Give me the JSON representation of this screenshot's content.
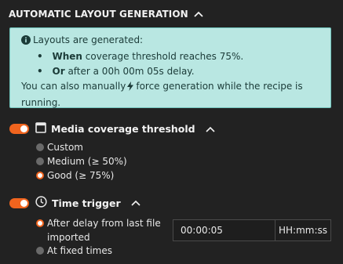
{
  "header": {
    "title": "AUTOMATIC LAYOUT GENERATION"
  },
  "info": {
    "intro": "Layouts are generated:",
    "bullet1_strong": "When",
    "bullet1_rest": " coverage threshold reaches 75%.",
    "bullet2_strong": "Or",
    "bullet2_rest": " after a 00h 00m 05s delay.",
    "manual_pre": "You can also manually",
    "manual_post": "force generation while the recipe is",
    "manual_last": "running."
  },
  "coverage": {
    "label": "Media coverage threshold",
    "enabled": true,
    "options": [
      {
        "label": "Custom",
        "selected": false
      },
      {
        "label": "Medium (≥ 50%)",
        "selected": false
      },
      {
        "label": "Good (≥ 75%)",
        "selected": true
      }
    ]
  },
  "time_trigger": {
    "label": "Time trigger",
    "enabled": true,
    "option_delay_line1": "After delay from last file",
    "option_delay_line2": "imported",
    "option_fixed": "At fixed times",
    "delay_value": "00:00:05",
    "delay_format": "HH:mm:ss"
  },
  "colors": {
    "accent": "#f0641e",
    "info_bg": "#b9e7e2",
    "background": "#222222"
  },
  "icons": [
    "chevron-up-icon",
    "info-icon",
    "bolt-icon",
    "image-frame-icon",
    "clock-icon"
  ]
}
